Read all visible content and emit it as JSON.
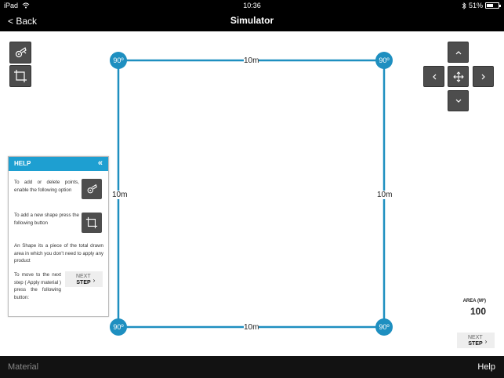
{
  "status_bar": {
    "carrier": "iPad",
    "time": "10:36",
    "battery": "51%",
    "battery_level": 0.51,
    "icons": [
      "wifi-icon",
      "bluetooth-icon",
      "battery-icon"
    ]
  },
  "nav": {
    "back_label": "< Back",
    "title": "Simulator"
  },
  "tools": {
    "point_tool_icon": "pointer-target-icon",
    "shape_tool_icon": "shape-crop-icon"
  },
  "pad": {
    "up": "^",
    "left": "<",
    "center_icon": "move-icon",
    "right": ">",
    "down": "v"
  },
  "shape": {
    "corners": [
      "90º",
      "90º",
      "90º",
      "90º"
    ],
    "sides": {
      "top": "10m",
      "right": "10m",
      "bottom": "10m",
      "left": "10m"
    },
    "line_color": "#1e8fc0"
  },
  "help_panel": {
    "title": "HELP",
    "collapse": "«",
    "text1": "To add or delete points, enable the following option",
    "text2": "To add a new shape press the following button",
    "text3": "An Shape its a piece of the total drawn area in which you don't need to apply any product",
    "text4": "To move to the next step ( Apply material ) press the following button:",
    "next_top": "NEXT",
    "next_bottom": "STEP",
    "next_chevron": "›"
  },
  "area": {
    "label": "AREA (M²)",
    "value": "100"
  },
  "next_step": {
    "top": "NEXT",
    "bottom": "STEP",
    "chevron": "›"
  },
  "bottom_bar": {
    "left": "Material",
    "right": "Help"
  },
  "colors": {
    "accent": "#1e9fd1",
    "bar": "#000000",
    "button": "#4d4d4d"
  }
}
